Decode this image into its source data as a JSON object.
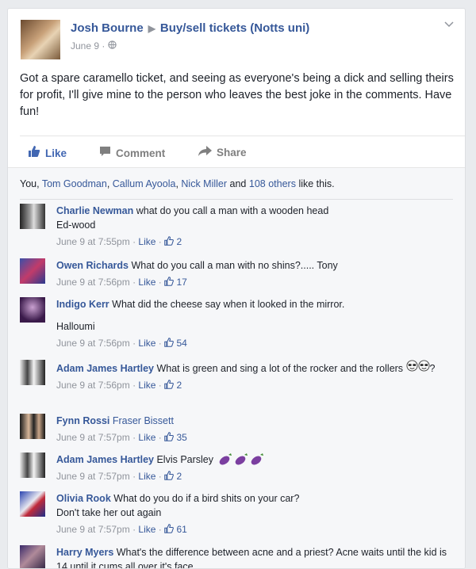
{
  "post": {
    "author": "Josh Bourne",
    "arrow": "▶",
    "group": "Buy/sell tickets (Notts uni)",
    "date": "June 9",
    "dot": "·",
    "text": "Got a spare caramello ticket, and seeing as everyone's being a dick and selling theirs for profit, I'll give mine to the person who leaves the best joke in the comments. Have fun!"
  },
  "actions": {
    "like": "Like",
    "comment": "Comment",
    "share": "Share"
  },
  "likes": {
    "you": "You,",
    "names": [
      "Tom Goodman",
      "Callum Ayoola",
      "Nick Miller"
    ],
    "and": "and",
    "others": "108 others",
    "suffix": "like this."
  },
  "comments": [
    {
      "author": "Charlie Newman",
      "text": "what do you call a man with a wooden head",
      "text2": "Ed-wood",
      "time": "June 9 at 7:55pm",
      "like": "Like",
      "count": "2"
    },
    {
      "author": "Owen Richards",
      "text": "What do you call a man with no shins?..... Tony",
      "text2": "",
      "time": "June 9 at 7:56pm",
      "like": "Like",
      "count": "17"
    },
    {
      "author": "Indigo Kerr",
      "text": "What did the cheese say when it looked in the mirror.",
      "text2": "Halloumi",
      "time": "June 9 at 7:56pm",
      "like": "Like",
      "count": "54"
    },
    {
      "author": "Adam James Hartley",
      "text": "What is green and sing a lot of the rocker and the rollers",
      "text2": "",
      "time": "June 9 at 7:56pm",
      "like": "Like",
      "count": "2"
    },
    {
      "author": "Fynn Rossi",
      "text": "Fraser Bissett",
      "text2": "",
      "time": "June 9 at 7:57pm",
      "like": "Like",
      "count": "35"
    },
    {
      "author": "Adam James Hartley",
      "text": "Elvis Parsley",
      "text2": "",
      "time": "June 9 at 7:57pm",
      "like": "Like",
      "count": "2"
    },
    {
      "author": "Olivia Rook",
      "text": "What do you do if a bird shits on your car?",
      "text2": "Don't take her out again",
      "time": "June 9 at 7:57pm",
      "like": "Like",
      "count": "61"
    },
    {
      "author": "Harry Myers",
      "text": "What's the difference between acne and a priest? Acne waits until the kid is 14 until it cums all over it's face",
      "text2": "",
      "time": "",
      "like": "",
      "count": ""
    }
  ],
  "meta_sep": "·",
  "colors": {
    "link": "#365899",
    "like_blue": "#4267b2",
    "muted": "#90949c",
    "bg": "#e9ebee"
  },
  "icons": [
    "globe-icon",
    "chevron-down-icon",
    "thumbs-up-icon",
    "comment-icon",
    "share-icon",
    "eggplant-icon",
    "sunglasses-emoji-icon"
  ]
}
